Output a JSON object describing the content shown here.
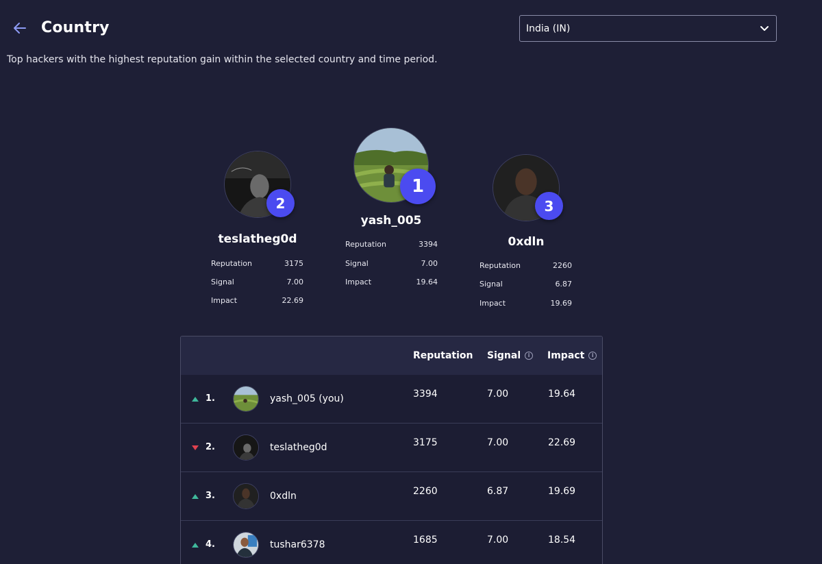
{
  "header": {
    "title": "Country",
    "country_select": "India (IN)",
    "subtitle": "Top hackers with the highest reputation gain within the selected country and time period."
  },
  "stat_labels": {
    "reputation": "Reputation",
    "signal": "Signal",
    "impact": "Impact"
  },
  "podium": {
    "first": {
      "rank": "1",
      "name": "yash_005",
      "reputation": "3394",
      "signal": "7.00",
      "impact": "19.64"
    },
    "second": {
      "rank": "2",
      "name": "teslatheg0d",
      "reputation": "3175",
      "signal": "7.00",
      "impact": "22.69"
    },
    "third": {
      "rank": "3",
      "name": "0xdln",
      "reputation": "2260",
      "signal": "6.87",
      "impact": "19.69"
    }
  },
  "table": {
    "columns": {
      "reputation": "Reputation",
      "signal": "Signal",
      "impact": "Impact"
    },
    "info_glyph": "i",
    "rows": [
      {
        "rank": "1.",
        "trend": "up",
        "name": "yash_005 (you)",
        "reputation": "3394",
        "signal": "7.00",
        "impact": "19.64"
      },
      {
        "rank": "2.",
        "trend": "down",
        "name": "teslatheg0d",
        "reputation": "3175",
        "signal": "7.00",
        "impact": "22.69"
      },
      {
        "rank": "3.",
        "trend": "up",
        "name": "0xdln",
        "reputation": "2260",
        "signal": "6.87",
        "impact": "19.69"
      },
      {
        "rank": "4.",
        "trend": "up",
        "name": "tushar6378",
        "reputation": "1685",
        "signal": "7.00",
        "impact": "18.54"
      }
    ]
  },
  "colors": {
    "background": "#1e1f36",
    "badge": "#4b4bf0",
    "trend_up": "#3fb89b",
    "trend_down": "#e0414f"
  },
  "icons": {
    "back": "arrow-left-icon",
    "dropdown": "chevron-down-icon",
    "info": "info-icon",
    "trend_up": "triangle-up-icon",
    "trend_down": "triangle-down-icon"
  }
}
